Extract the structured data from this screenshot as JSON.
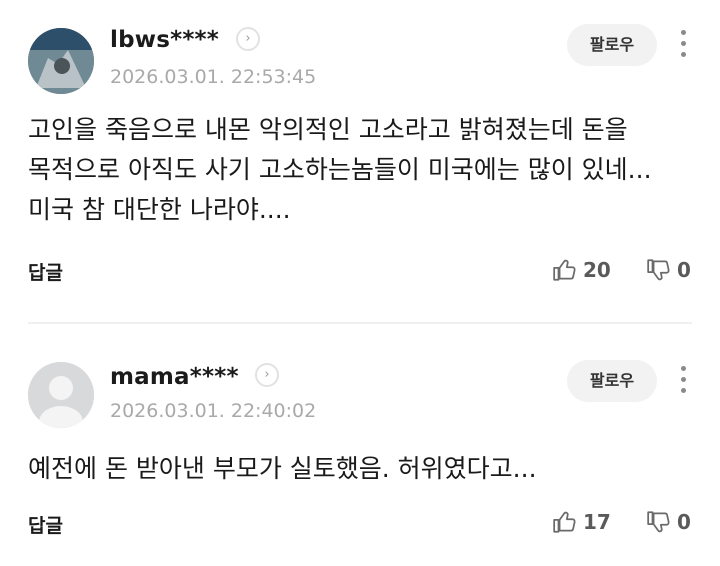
{
  "comments": [
    {
      "username": "lbws****",
      "timestamp": "2026.03.01. 22:53:45",
      "follow_label": "팔로우",
      "body": "고인을 죽음으로 내몬 악의적인 고소라고 밝혀졌는데 돈을 목적으로 아직도 사기 고소하는놈들이 미국에는 많이 있네...미국 참 대단한 나라야....",
      "reply_label": "답글",
      "likes": "20",
      "dislikes": "0",
      "avatar_icon": "profile-photo"
    },
    {
      "username": "mama****",
      "timestamp": "2026.03.01. 22:40:02",
      "follow_label": "팔로우",
      "body": "예전에 돈 받아낸 부모가 실토했음. 허위였다고...",
      "reply_label": "답글",
      "likes": "17",
      "dislikes": "0",
      "avatar_icon": "default-user"
    }
  ],
  "icons": {
    "profile_arrow": "chevron-right-icon",
    "more": "more-vertical-icon",
    "like": "thumbs-up-icon",
    "dislike": "thumbs-down-icon"
  }
}
